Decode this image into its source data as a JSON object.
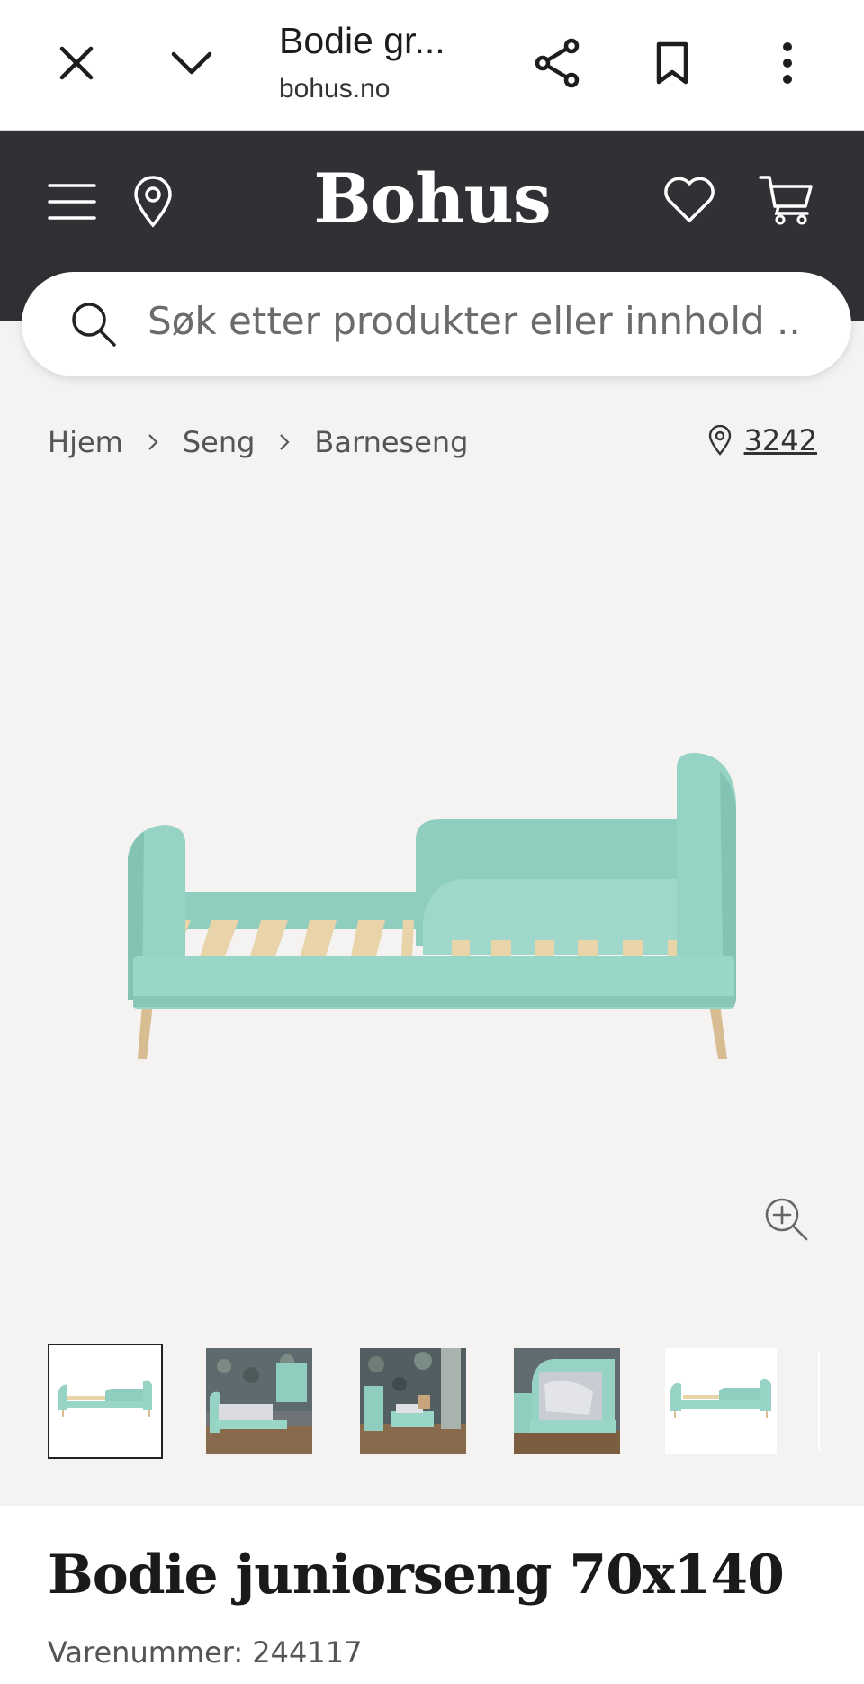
{
  "browser": {
    "title": "Bodie gr...",
    "url": "bohus.no",
    "icons": [
      "close-icon",
      "chevron-down-icon",
      "share-icon",
      "bookmark-icon",
      "more-vert-icon"
    ]
  },
  "header": {
    "logo": "Bohus",
    "icons": [
      "menu-icon",
      "location-pin-icon",
      "heart-icon",
      "cart-icon"
    ]
  },
  "search": {
    "placeholder": "Søk etter produkter eller innhold .."
  },
  "breadcrumb": {
    "items": [
      "Hjem",
      "Seng",
      "Barneseng"
    ],
    "store_number": "3242"
  },
  "gallery": {
    "thumbnail_count": 5,
    "selected_index": 0
  },
  "product": {
    "title": "Bodie juniorseng 70x140",
    "sku": "Varenummer: 244117"
  },
  "colors": {
    "header_bg": "#313034",
    "page_bg": "#f4f3f1",
    "bed_mint": "#96d3c4",
    "slat_wood": "#e8d4a8"
  }
}
